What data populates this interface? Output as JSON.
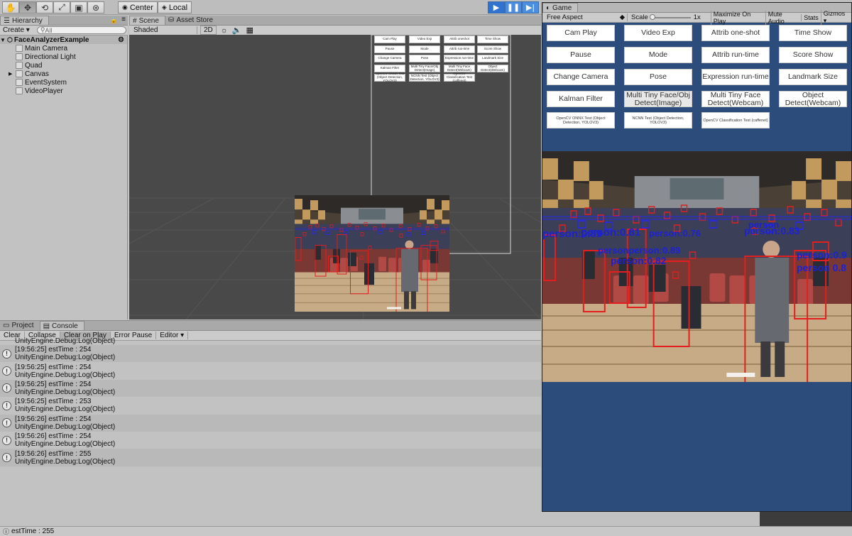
{
  "toolbar": {
    "pivot_label": "Center",
    "space_label": "Local",
    "transform_tools": [
      "hand-tool",
      "move-tool",
      "rotate-tool",
      "scale-tool",
      "rect-tool",
      "transform-tool"
    ],
    "play_controls": [
      "play",
      "pause",
      "step"
    ],
    "colors": {
      "play_active": "#2f72cf"
    }
  },
  "hierarchy": {
    "tab_label": "Hierarchy",
    "create_label": "Create",
    "search_placeholder": "All",
    "scene_name": "FaceAnalyzerExample",
    "items": [
      {
        "label": "Main Camera",
        "expandable": false
      },
      {
        "label": "Directional Light",
        "expandable": false
      },
      {
        "label": "Quad",
        "expandable": false
      },
      {
        "label": "Canvas",
        "expandable": true
      },
      {
        "label": "EventSystem",
        "expandable": false
      },
      {
        "label": "VideoPlayer",
        "expandable": false
      }
    ]
  },
  "scene": {
    "tabs": [
      "Scene",
      "Asset Store"
    ],
    "shading_mode": "Shaded",
    "mode_2d": "2D"
  },
  "console": {
    "tabs": [
      "Project",
      "Console"
    ],
    "buttons": [
      "Clear",
      "Collapse",
      "Clear on Play",
      "Error Pause",
      "Editor"
    ],
    "logs": [
      {
        "line1": "",
        "line2": "UnityEngine.Debug:Log(Object)"
      },
      {
        "line1": "[19:56:25] estTime : 254",
        "line2": "UnityEngine.Debug:Log(Object)"
      },
      {
        "line1": "[19:56:25] estTime : 254",
        "line2": "UnityEngine.Debug:Log(Object)"
      },
      {
        "line1": "[19:56:25] estTime : 254",
        "line2": "UnityEngine.Debug:Log(Object)"
      },
      {
        "line1": "[19:56:25] estTime : 253",
        "line2": "UnityEngine.Debug:Log(Object)"
      },
      {
        "line1": "[19:56:26] estTime : 254",
        "line2": "UnityEngine.Debug:Log(Object)"
      },
      {
        "line1": "[19:56:26] estTime : 254",
        "line2": "UnityEngine.Debug:Log(Object)"
      },
      {
        "line1": "[19:56:26] estTime : 255",
        "line2": "UnityEngine.Debug:Log(Object)"
      }
    ]
  },
  "status_bar": {
    "text": "estTime : 255"
  },
  "game": {
    "tab_label": "Game",
    "aspect": "Free Aspect",
    "scale_label": "Scale",
    "scale_value": "1x",
    "toggles": [
      "Maximize On Play",
      "Mute Audio",
      "Stats",
      "Gizmos"
    ],
    "buttons": [
      [
        "Cam Play",
        "Video Exp",
        "Attrib one-shot",
        "Time Show"
      ],
      [
        "Pause",
        "Mode",
        "Attrib run-time",
        "Score Show"
      ],
      [
        "Change Camera",
        "Pose",
        "Expression run-time",
        "Landmark Size"
      ],
      [
        "Kalman Filter",
        "Multi Tiny Face/Obj Detect(Image)",
        "Multi Tiny Face Detect(Webcam)",
        "Object Detect(Webcam)"
      ],
      [
        "OpenCV ONNX Test (Object Detection, YOLOV3)",
        "NCNN Test (Object Detection, YOLOV3)",
        "OpenCV Classification Test (caffenet)"
      ]
    ],
    "detection_labels": [
      "person:0.89",
      "person:0.81",
      "personperson:0.89",
      "person:0.82",
      "person:0.76",
      "person:0.83",
      "person",
      "person:0.9",
      "person 0.8"
    ],
    "colors": {
      "background": "#2c4c7c",
      "face_box": "#e31e1e",
      "label": "#1c22d4"
    }
  },
  "mini_buttons": [
    [
      "Cam Play",
      "Video Exp",
      "Attrib oneshot",
      "Time Show"
    ],
    [
      "Pause",
      "Mode",
      "Attrib run-time",
      "Score Show"
    ],
    [
      "Change Camera",
      "Pose",
      "Expression run-time",
      "Landmark Size"
    ],
    [
      "Kalman Filter",
      "Multi Tiny Face/Obj Detect(Image)",
      "Multi Tiny Face Detect(Webcam)",
      "Object Detect(Webcam)"
    ],
    [
      "OpenCV ONNX Test (Object Detection, YOLOV3)",
      "NCNN Test (Object Detection, YOLOV3)",
      "OpenCV Classification Test (caffenet)"
    ]
  ]
}
